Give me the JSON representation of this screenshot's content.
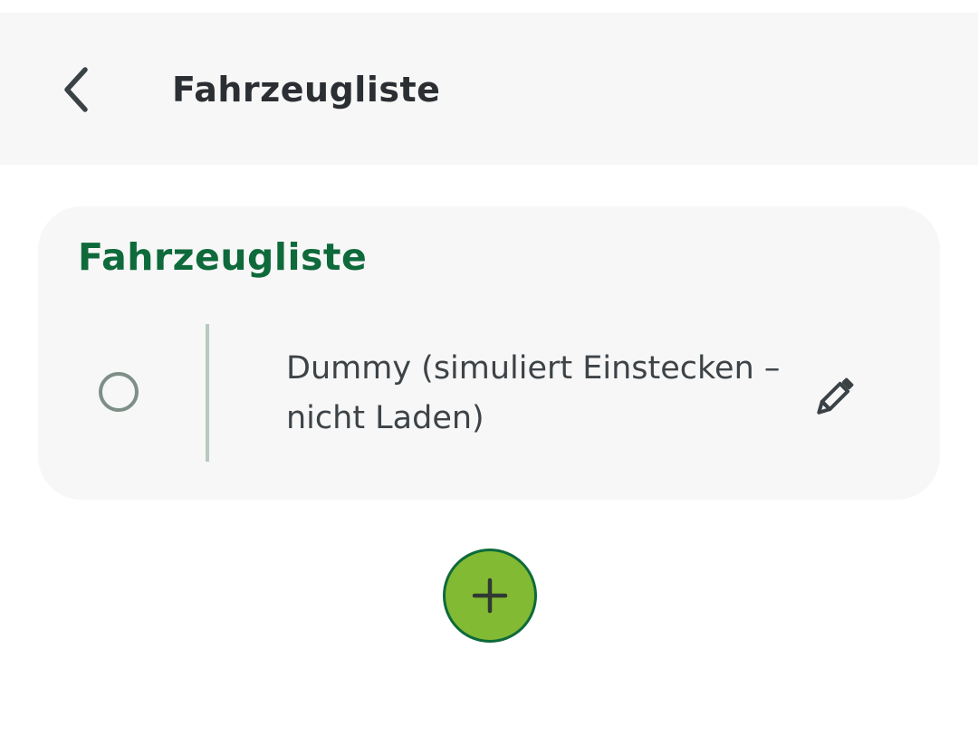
{
  "app_bar": {
    "title": "Fahrzeugliste",
    "back_icon": "chevron-left-icon"
  },
  "vehicle_list": {
    "title": "Fahrzeugliste",
    "items": [
      {
        "name": "Dummy (simuliert Einstecken – nicht Laden)",
        "selected": false,
        "edit_icon": "pencil-icon"
      }
    ]
  },
  "fab": {
    "icon": "plus-icon"
  },
  "colors": {
    "accent_green": "#0e6a3b",
    "fab_green": "#83ba33",
    "surface": "#f7f7f7",
    "text_dark": "#2b2f33"
  }
}
